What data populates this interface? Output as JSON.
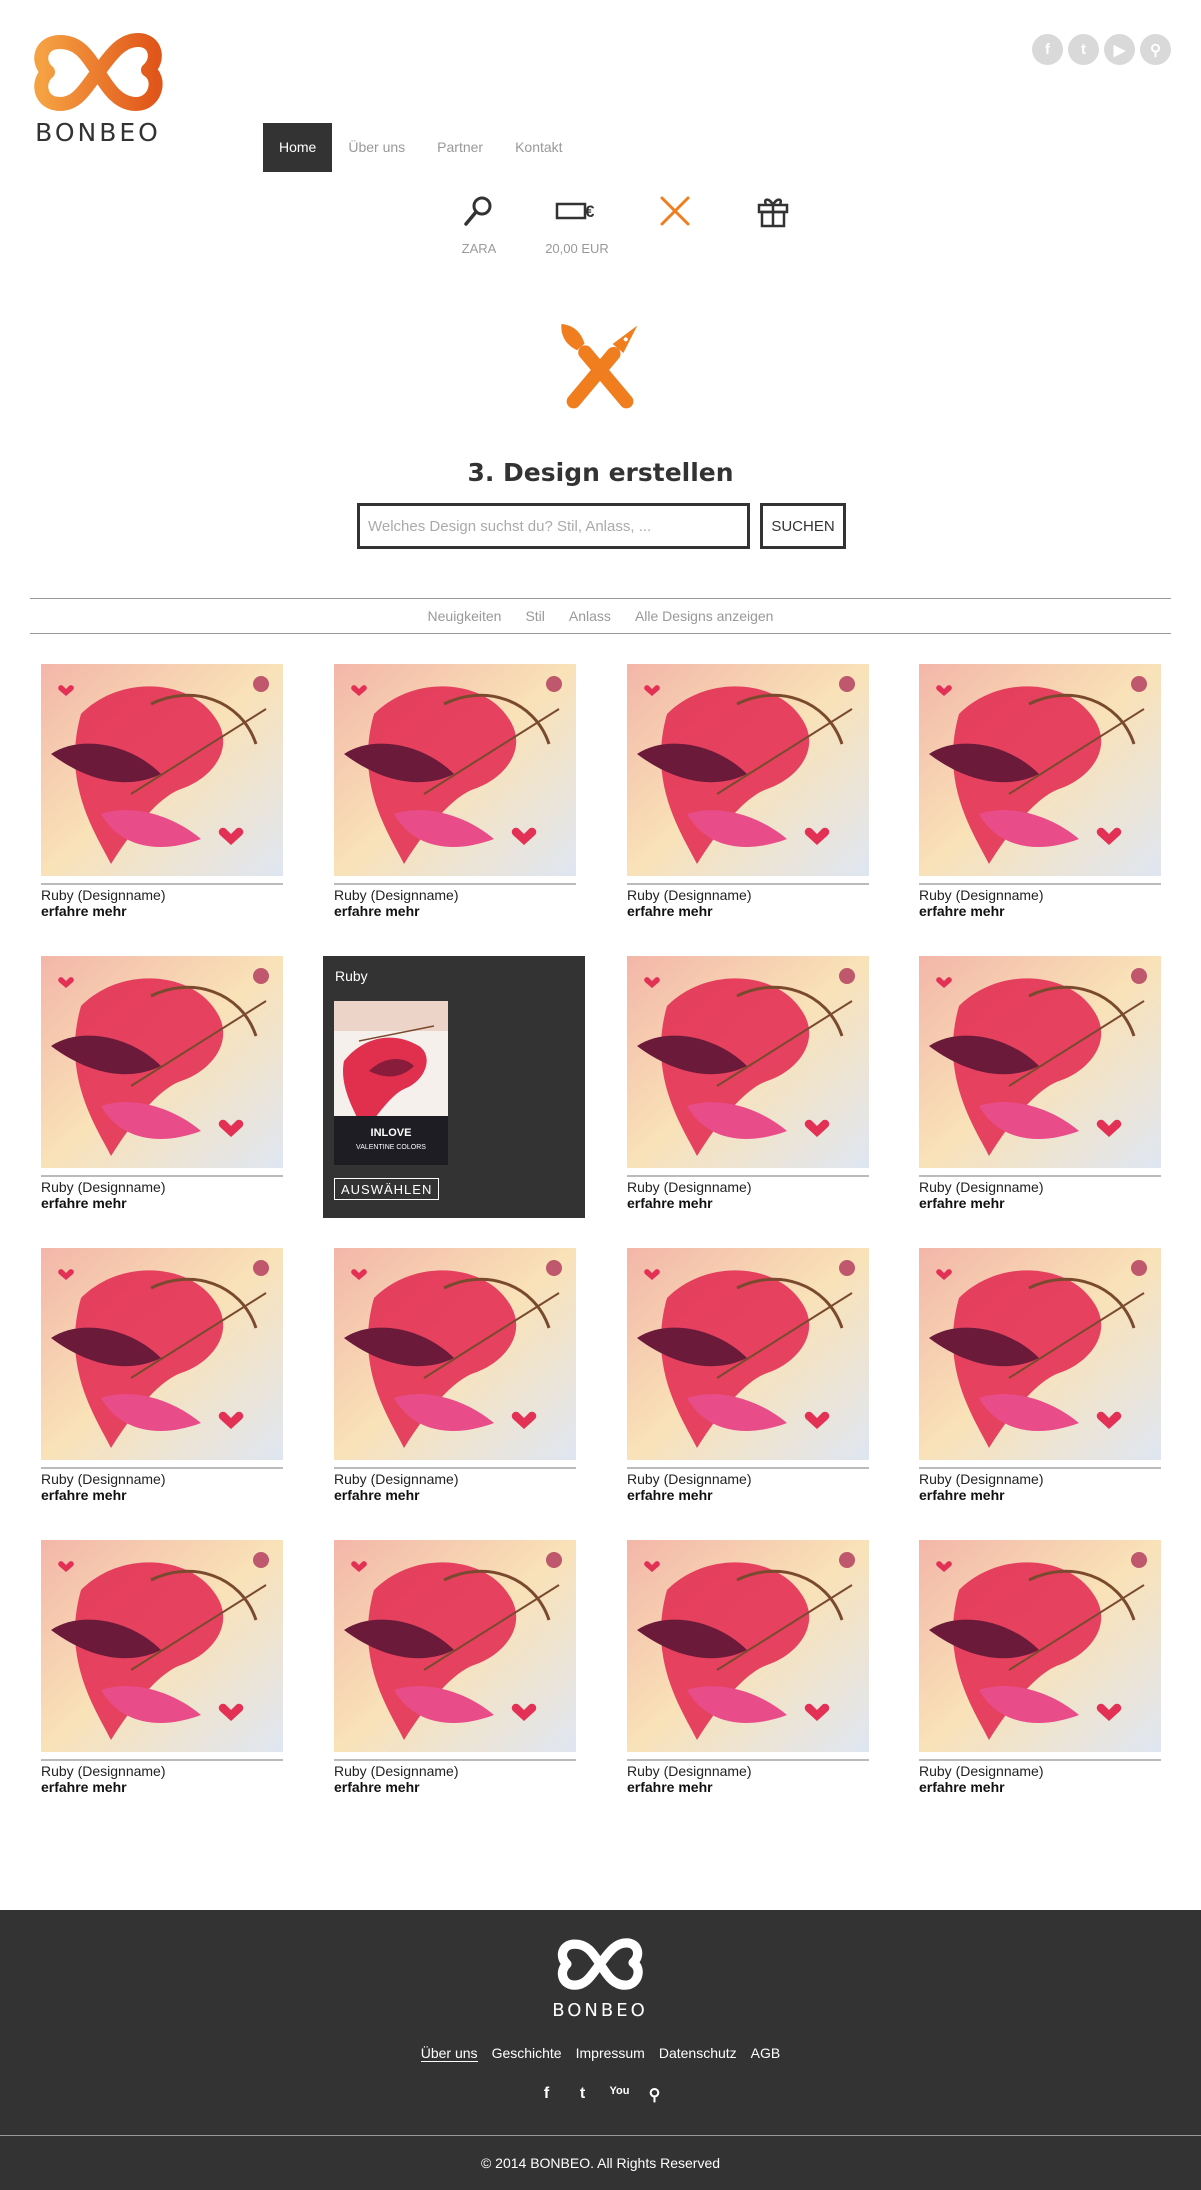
{
  "brand": {
    "name": "BONBEO",
    "accent": "#f07d1e"
  },
  "social_top": [
    {
      "icon": "facebook-icon",
      "glyph": "f"
    },
    {
      "icon": "twitter-icon",
      "glyph": "t"
    },
    {
      "icon": "youtube-icon",
      "glyph": "▶"
    },
    {
      "icon": "search-icon",
      "glyph": "⚲"
    }
  ],
  "nav": {
    "items": [
      "Home",
      "Über uns",
      "Partner",
      "Kontakt"
    ],
    "active": "Home"
  },
  "steps": [
    {
      "icon": "search-icon",
      "label": "ZARA"
    },
    {
      "icon": "voucher-value-icon",
      "label": "20,00 EUR"
    },
    {
      "icon": "design-brush-pen-icon",
      "label": ""
    },
    {
      "icon": "gift-icon",
      "label": ""
    }
  ],
  "hero": {
    "title": "3. Design erstellen",
    "search_placeholder": "Welches Design suchst du? Stil, Anlass, ...",
    "search_button": "SUCHEN"
  },
  "filters": [
    "Neuigkeiten",
    "Stil",
    "Anlass",
    "Alle Designs anzeigen"
  ],
  "card": {
    "name": "Ruby (Designname)",
    "more": "erfahre mehr"
  },
  "selected": {
    "title": "Ruby",
    "button": "AUSWÄHLEN",
    "poster_lines": [
      "INLOVE",
      "VALENTINE COLORS"
    ]
  },
  "footer": {
    "brand": "BONBEO",
    "links": [
      "Über uns",
      "Geschichte",
      "Impressum",
      "Datenschutz",
      "AGB"
    ],
    "active_link": "Über uns",
    "social": [
      {
        "icon": "facebook-icon",
        "glyph": "f"
      },
      {
        "icon": "twitter-icon",
        "glyph": "t"
      },
      {
        "icon": "youtube-icon",
        "glyph": "You"
      },
      {
        "icon": "search-icon",
        "glyph": "⚲"
      }
    ],
    "copyright": "© 2014 BONBEO. All Rights Reserved"
  }
}
